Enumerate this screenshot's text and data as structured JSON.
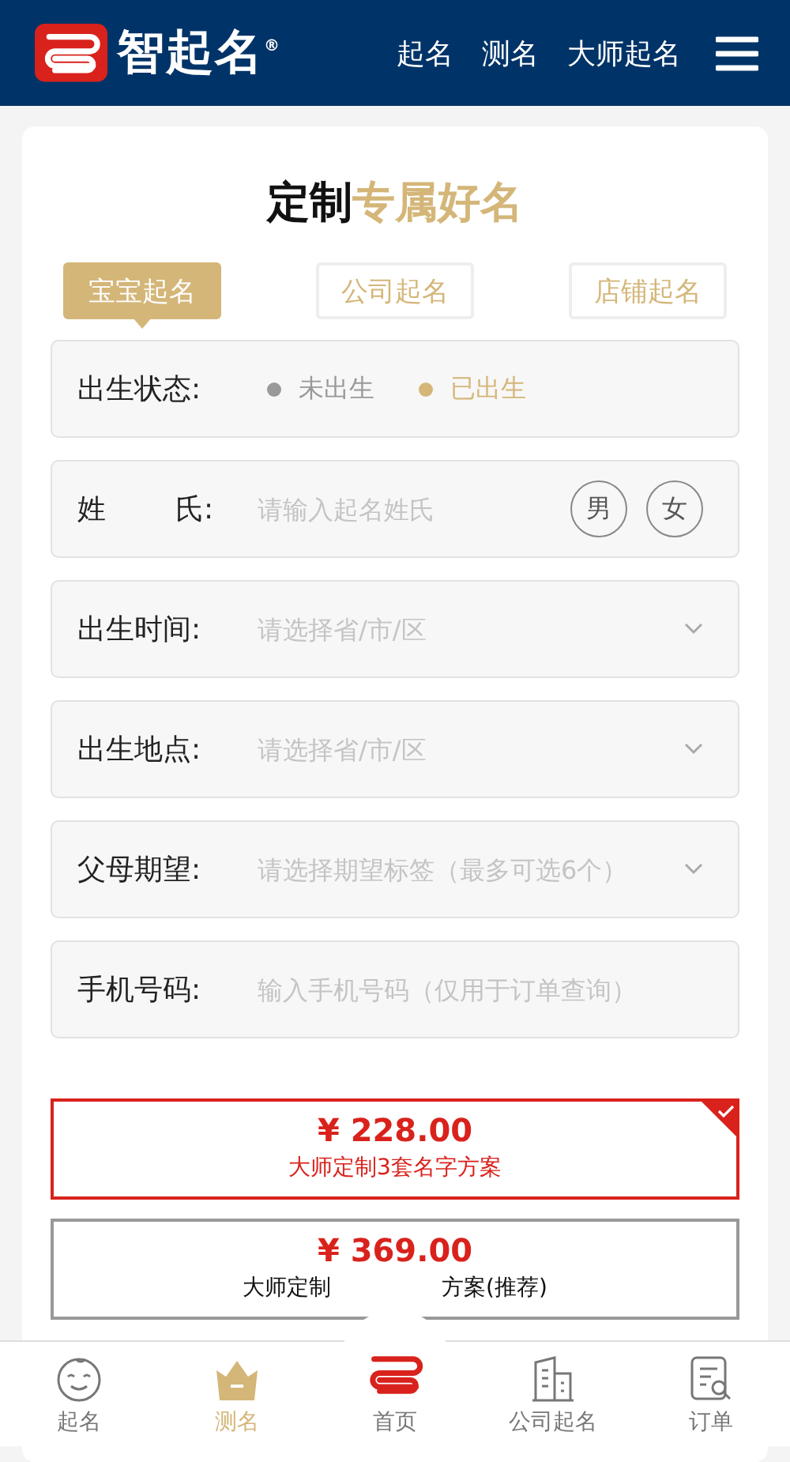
{
  "header": {
    "brand": "智起名",
    "registered": "®",
    "links": [
      "起名",
      "测名",
      "大师起名"
    ]
  },
  "title": {
    "lead": "定制",
    "accent": "专属好名"
  },
  "tabs": [
    {
      "label": "宝宝起名",
      "selected": true
    },
    {
      "label": "公司起名",
      "selected": false
    },
    {
      "label": "店铺起名",
      "selected": false
    }
  ],
  "fields": [
    {
      "kind": "radio",
      "label": "出生状态:",
      "options": [
        {
          "label": "未出生",
          "selected": false
        },
        {
          "label": "已出生",
          "selected": true
        }
      ]
    },
    {
      "kind": "surname",
      "label_start": "姓",
      "label_end": "氏:",
      "placeholder": "请输入起名姓氏",
      "genders": [
        {
          "label": "男",
          "selected": false
        },
        {
          "label": "女",
          "selected": false
        }
      ]
    },
    {
      "kind": "select",
      "label": "出生时间:",
      "placeholder": "请选择省/市/区"
    },
    {
      "kind": "select",
      "label": "出生地点:",
      "placeholder": "请选择省/市/区"
    },
    {
      "kind": "select",
      "label": "父母期望:",
      "placeholder": "请选择期望标签（最多可选6个）"
    },
    {
      "kind": "input",
      "label": "手机号码:",
      "placeholder": "输入手机号码（仅用于订单查询）"
    }
  ],
  "plans": [
    {
      "price": "¥ 228.00",
      "description": [
        "大师定制3套名字方案"
      ],
      "selected": true
    },
    {
      "price": "¥ 369.00",
      "description": [
        "大师定制",
        "方案(推荐)"
      ],
      "selected": false
    }
  ],
  "bottom_nav": [
    {
      "kind": "baby",
      "label": "起名",
      "selected": false
    },
    {
      "kind": "crown",
      "label": "测名",
      "selected": true
    },
    {
      "kind": "home",
      "label": "首页",
      "selected": false
    },
    {
      "kind": "building",
      "label": "公司起名",
      "selected": false
    },
    {
      "kind": "order",
      "label": "订单",
      "selected": false
    }
  ]
}
